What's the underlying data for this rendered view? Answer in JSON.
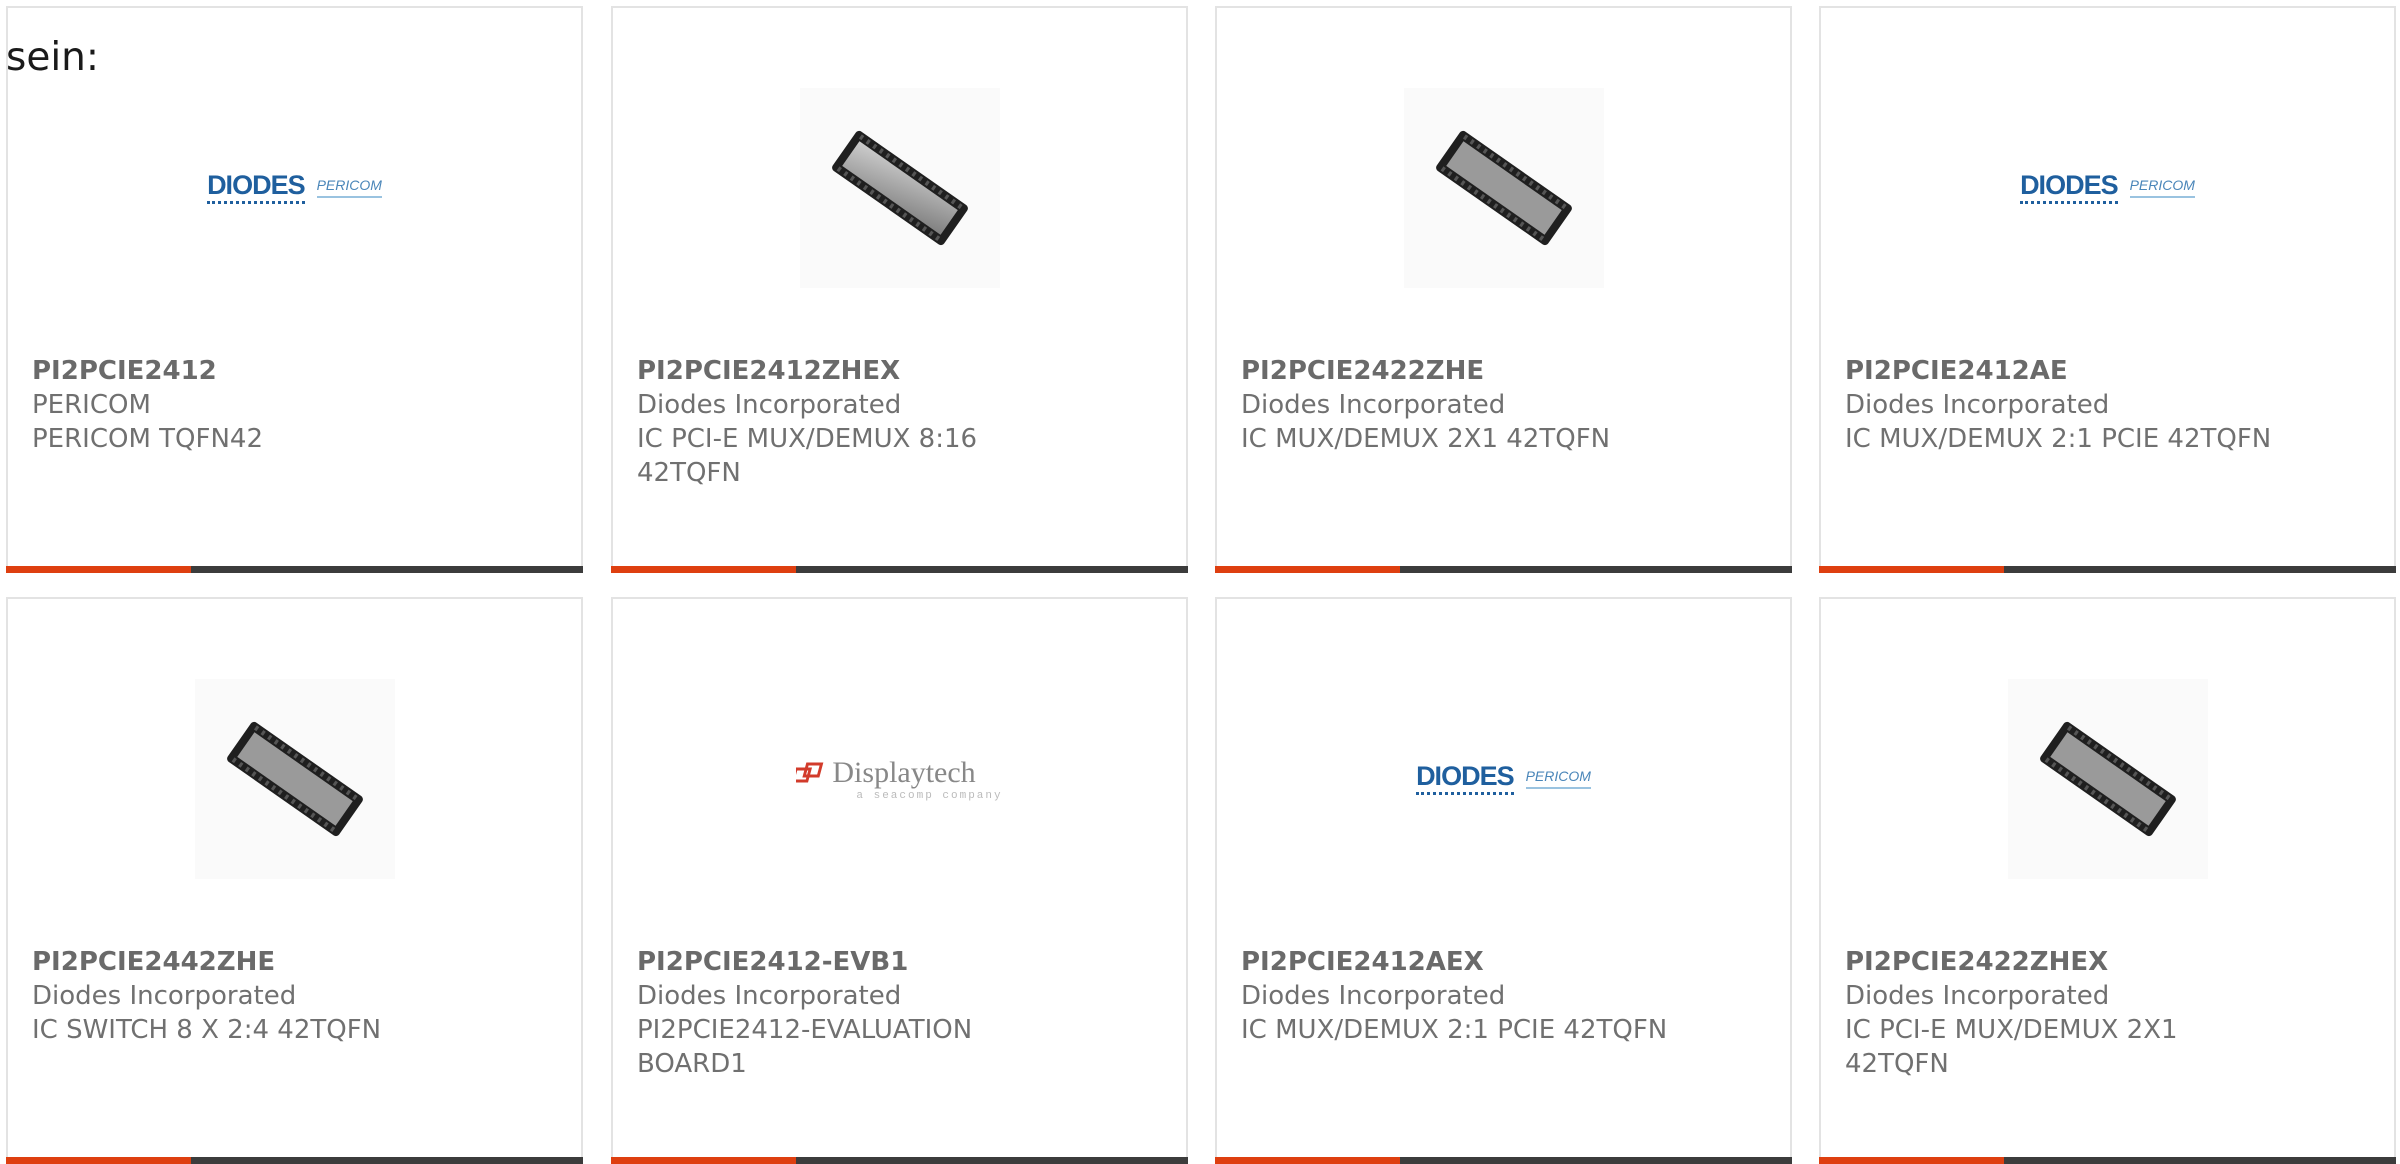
{
  "intro_text": "sein:",
  "products": [
    {
      "name": "PI2PCIE2412",
      "manufacturer": "PERICOM",
      "description": "PERICOM TQFN42",
      "image": "diodes-pericom-logo"
    },
    {
      "name": "PI2PCIE2412ZHEX",
      "manufacturer": "Diodes Incorporated",
      "description": "IC PCI-E MUX/DEMUX 8:16 42TQFN",
      "image": "chip-package"
    },
    {
      "name": "PI2PCIE2422ZHE",
      "manufacturer": "Diodes Incorporated",
      "description": "IC MUX/DEMUX 2X1 42TQFN",
      "image": "chip-package"
    },
    {
      "name": "PI2PCIE2412AE",
      "manufacturer": "Diodes Incorporated",
      "description": "IC MUX/DEMUX 2:1 PCIE 42TQFN",
      "image": "diodes-pericom-logo"
    },
    {
      "name": "PI2PCIE2442ZHE",
      "manufacturer": "Diodes Incorporated",
      "description": "IC SWITCH 8 X 2:4 42TQFN",
      "image": "chip-package"
    },
    {
      "name": "PI2PCIE2412-EVB1",
      "manufacturer": "Diodes Incorporated",
      "description": "PI2PCIE2412-EVALUATION BOARD1",
      "image": "displaytech-logo"
    },
    {
      "name": "PI2PCIE2412AEX",
      "manufacturer": "Diodes Incorporated",
      "description": "IC MUX/DEMUX 2:1 PCIE 42TQFN",
      "image": "diodes-pericom-logo"
    },
    {
      "name": "PI2PCIE2422ZHEX",
      "manufacturer": "Diodes Incorporated",
      "description": "IC PCI-E MUX/DEMUX 2X1 42TQFN",
      "image": "chip-package"
    }
  ],
  "logos": {
    "diodes_wordmark": "DIODES",
    "pericom_wordmark": "PERICOM",
    "displaytech_wordmark": "Displaytech",
    "displaytech_tagline": "a seacomp company"
  },
  "colors": {
    "accent": "#de3f10",
    "bar_dark": "#3c3c3c",
    "card_border": "#e3e3e3",
    "text": "#707070"
  }
}
